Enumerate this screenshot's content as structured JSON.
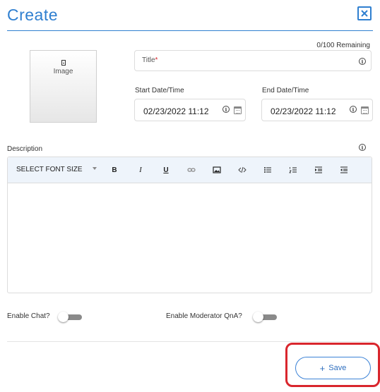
{
  "dialog": {
    "title": "Create",
    "close_icon": "close-icon"
  },
  "form": {
    "remaining": "0/100 Remaining",
    "image_label": "Image",
    "title_label": "Title",
    "title_required_mark": "*",
    "start_label": "Start Date/Time",
    "start_value": "02/23/2022 11:12",
    "end_label": "End Date/Time",
    "end_value": "02/23/2022 11:12",
    "description_label": "Description",
    "font_size_select": "SELECT FONT SIZE",
    "toolbar": {
      "bold": "B",
      "italic": "I",
      "underline": "U"
    },
    "enable_chat_label": "Enable Chat?",
    "enable_chat": false,
    "enable_qna_label": "Enable Moderator QnA?",
    "enable_qna": false,
    "save_label": "Save",
    "save_icon": "+"
  },
  "colors": {
    "accent": "#2f7fd0",
    "highlight": "#d9262d",
    "toggle_off": "#8a8a8a"
  }
}
